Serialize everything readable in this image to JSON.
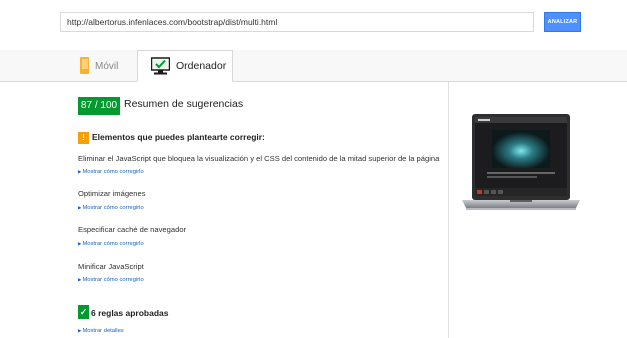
{
  "search": {
    "url_value": "http://albertorus.infenlaces.com/bootstrap/dist/multi.html",
    "analyze_label": "ANALIZAR"
  },
  "tabs": [
    {
      "label": "Móvil",
      "icon": "phone-icon"
    },
    {
      "label": "Ordenador",
      "icon": "monitor-icon"
    }
  ],
  "summary": {
    "score": "87 / 100",
    "title": "Resumen de sugerencias"
  },
  "warnings": {
    "badge": "!",
    "title": "Elementos que puedes plantearte corregir:",
    "rules": [
      {
        "title": "Eliminar el JavaScript que bloquea la visualización y el CSS del contenido de la mitad superior de la página",
        "link": "Mostrar cómo corregirlo"
      },
      {
        "title": "Optimizar imágenes",
        "link": "Mostrar cómo corregirlo"
      },
      {
        "title": "Especificar caché de navegador",
        "link": "Mostrar cómo corregirlo"
      },
      {
        "title": "Minificar JavaScript",
        "link": "Mostrar cómo corregirlo"
      }
    ]
  },
  "passed": {
    "title": "6 reglas aprobadas",
    "link": "Mostrar detalles"
  },
  "colors": {
    "score_green": "#009a2e",
    "warning_orange": "#f4a00a",
    "link_blue": "#1a62c9",
    "button_blue": "#4d90fe"
  }
}
